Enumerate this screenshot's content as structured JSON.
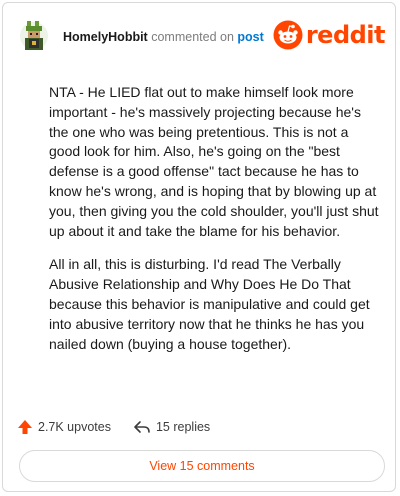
{
  "header": {
    "username": "HomelyHobbit",
    "commented_text": "commented on",
    "post_link": "post",
    "brand": "reddit"
  },
  "comment": {
    "paragraphs": [
      "NTA - He LIED flat out to make himself look more important - he's massively projecting because he's the one who was being pretentious. This is not a good look for him. Also, he's going on the \"best defense is a good offense\" tact because he has to know he's wrong, and is hoping that by blowing up at you, then giving you the cold shoulder, you'll just shut up about it and take the blame for his behavior.",
      "All in all, this is disturbing. I'd read The Verbally Abusive Relationship and Why Does He Do That because this behavior is manipulative and could get into abusive territory now that he thinks he has you nailed down (buying a house together)."
    ]
  },
  "actions": {
    "upvotes": "2.7K upvotes",
    "replies": "15 replies",
    "upvote_icon": "upvote-arrow-icon",
    "reply_icon": "reply-arrow-icon"
  },
  "view_button": {
    "label": "View 15 comments"
  },
  "colors": {
    "brand": "#ff4500",
    "link": "#0079d3",
    "muted": "#7c7c7c"
  }
}
